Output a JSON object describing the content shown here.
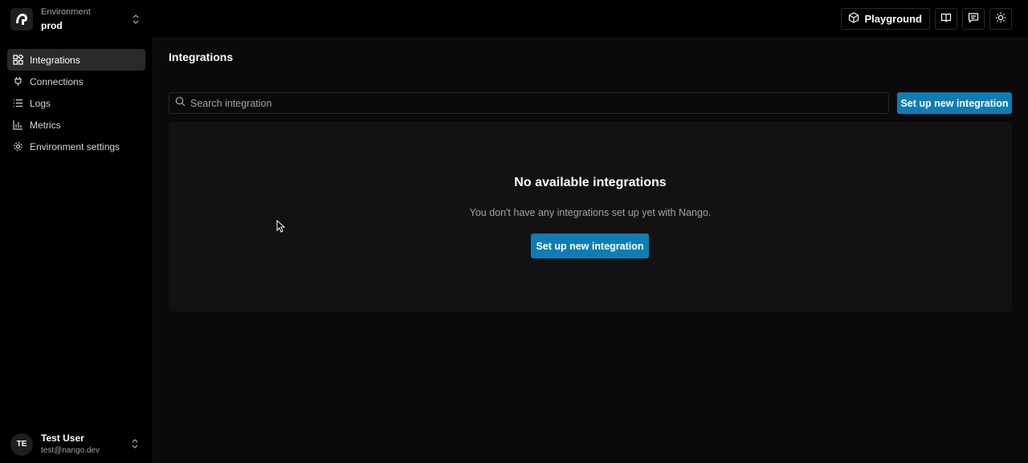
{
  "environment": {
    "label": "Environment",
    "value": "prod"
  },
  "top_actions": {
    "playground_label": "Playground"
  },
  "sidebar": {
    "items": [
      {
        "label": "Integrations",
        "icon": "integrations-icon",
        "active": true
      },
      {
        "label": "Connections",
        "icon": "plug-icon",
        "active": false
      },
      {
        "label": "Logs",
        "icon": "list-icon",
        "active": false
      },
      {
        "label": "Metrics",
        "icon": "bar-chart-icon",
        "active": false
      },
      {
        "label": "Environment settings",
        "icon": "gear-icon",
        "active": false
      }
    ]
  },
  "user": {
    "initials": "TE",
    "name": "Test User",
    "email": "test@nango.dev"
  },
  "main": {
    "title": "Integrations",
    "search": {
      "placeholder": "Search integration",
      "value": ""
    },
    "new_integration_label": "Set up new integration",
    "empty_state": {
      "title": "No available integrations",
      "description": "You don't have any integrations set up yet with Nango.",
      "button_label": "Set up new integration"
    }
  },
  "colors": {
    "accent": "#0e7db4",
    "background": "#0a0a0a",
    "sidebar": "#000000"
  }
}
